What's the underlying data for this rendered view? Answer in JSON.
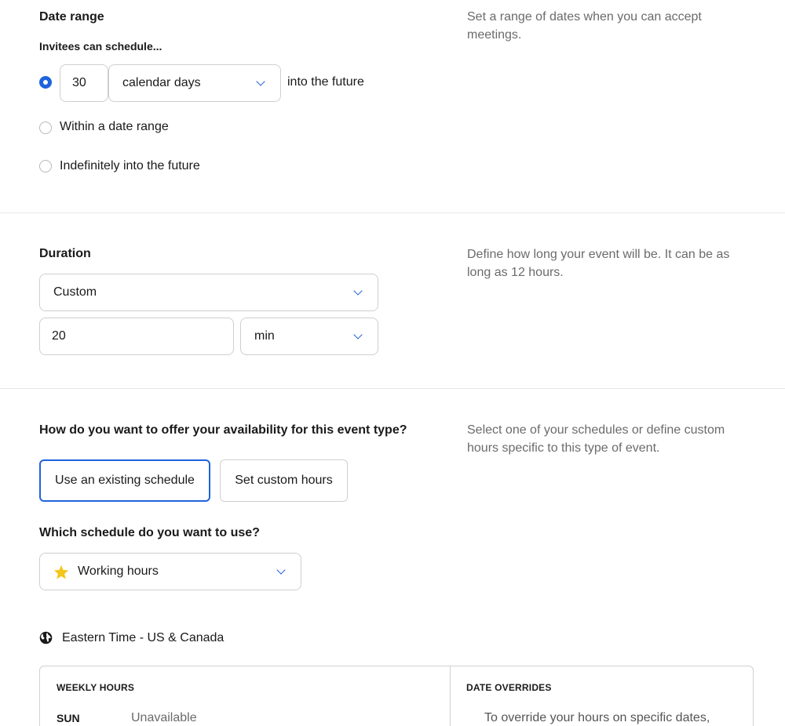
{
  "date_range": {
    "title": "Date range",
    "help": "Set a range of dates when you can accept meetings.",
    "invitees_label": "Invitees can schedule...",
    "days_value": "30",
    "days_unit": "calendar days",
    "into_future": "into the future",
    "options": [
      "Within a date range",
      "Indefinitely into the future"
    ]
  },
  "duration": {
    "title": "Duration",
    "help": "Define how long your event will be. It can be as long as 12 hours.",
    "preset": "Custom",
    "value": "20",
    "unit": "min"
  },
  "availability": {
    "question": "How do you want to offer your availability for this event type?",
    "help": "Select one of your schedules or define custom hours specific to this type of event.",
    "existing_button": "Use an existing schedule",
    "custom_button": "Set custom hours",
    "schedule_question": "Which schedule do you want to use?",
    "schedule_value": "Working hours",
    "timezone": "Eastern Time - US & Canada"
  },
  "table": {
    "weekly_header": "WEEKLY HOURS",
    "overrides_header": "DATE OVERRIDES",
    "row_day": "SUN",
    "row_value": "Unavailable",
    "override_text": "To override your hours on specific dates,"
  },
  "colors": {
    "accent": "#1f63dd",
    "star": "#f5c518"
  }
}
